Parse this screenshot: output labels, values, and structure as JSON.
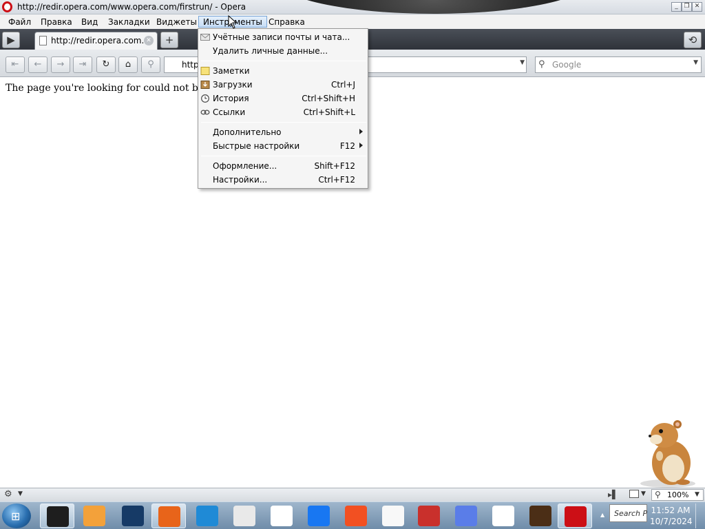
{
  "window": {
    "title": "http://redir.opera.com/www.opera.com/firstrun/ - Opera",
    "controls": {
      "minimize": "_",
      "restore": "❐",
      "close": "✕"
    }
  },
  "menubar": {
    "items": [
      {
        "label": "Файл"
      },
      {
        "label": "Правка"
      },
      {
        "label": "Вид"
      },
      {
        "label": "Закладки"
      },
      {
        "label": "Виджеты"
      },
      {
        "label": "Инструменты",
        "active": true
      },
      {
        "label": "Справка"
      }
    ]
  },
  "tabbar": {
    "tab_label": "http://redir.opera.com...",
    "new_tab_glyph": "+",
    "panel_glyph": "▶",
    "closed_tabs_glyph": "⟲"
  },
  "navbar": {
    "buttons": [
      "rewind-icon",
      "back-icon",
      "forward-icon",
      "fast-forward-icon",
      "reload-icon",
      "home-icon",
      "wand-icon"
    ],
    "address_value": "http",
    "search_placeholder": "Google"
  },
  "content": {
    "message": "The page you're looking for could not be found"
  },
  "tools_menu": {
    "sections": [
      [
        {
          "label": "Учётные записи почты и чата...",
          "icon": "mail-icon"
        },
        {
          "label": "Удалить личные данные..."
        }
      ],
      [
        {
          "label": "Заметки",
          "icon": "notes-icon"
        },
        {
          "label": "Загрузки",
          "icon": "downloads-icon",
          "shortcut": "Ctrl+J"
        },
        {
          "label": "История",
          "icon": "history-icon",
          "shortcut": "Ctrl+Shift+H"
        },
        {
          "label": "Ссылки",
          "icon": "links-icon",
          "shortcut": "Ctrl+Shift+L"
        }
      ],
      [
        {
          "label": "Дополнительно",
          "submenu": true
        },
        {
          "label": "Быстрые настройки",
          "shortcut": "F12",
          "submenu": true
        }
      ],
      [
        {
          "label": "Оформление...",
          "shortcut": "Shift+F12"
        },
        {
          "label": "Настройки...",
          "shortcut": "Ctrl+F12"
        }
      ]
    ]
  },
  "statusbar": {
    "zoom": "100%"
  },
  "taskbar": {
    "apps": [
      {
        "name": "terminal-app",
        "active": true,
        "color": "#1e1e1e"
      },
      {
        "name": "media-player-app",
        "color": "#f3a13a"
      },
      {
        "name": "globe-app",
        "color": "#163a66"
      },
      {
        "name": "firefox-app",
        "active": true,
        "color": "#e8641a"
      },
      {
        "name": "edge-app",
        "color": "#1f8ad6"
      },
      {
        "name": "youtube-app",
        "color": "#e9e9e9"
      },
      {
        "name": "amazon-app",
        "color": "#ffffff"
      },
      {
        "name": "facebook-app",
        "color": "#1877f2"
      },
      {
        "name": "microsoft-app",
        "color": "#f25022"
      },
      {
        "name": "wikipedia-app",
        "color": "#f8f8f8"
      },
      {
        "name": "store-app",
        "color": "#c9302c"
      },
      {
        "name": "copilot-app",
        "color": "#5a7de8"
      },
      {
        "name": "bank-of-america-app",
        "color": "#ffffff"
      },
      {
        "name": "ups-app",
        "color": "#4b2e16"
      },
      {
        "name": "opera-app",
        "active": true,
        "color": "#cc0f16"
      }
    ],
    "search_text": "Search P",
    "time": "11:52 AM",
    "date": "10/7/2024"
  },
  "colors": {
    "opera_red": "#cc0f16",
    "menu_highlight": "#c7ddf5"
  }
}
